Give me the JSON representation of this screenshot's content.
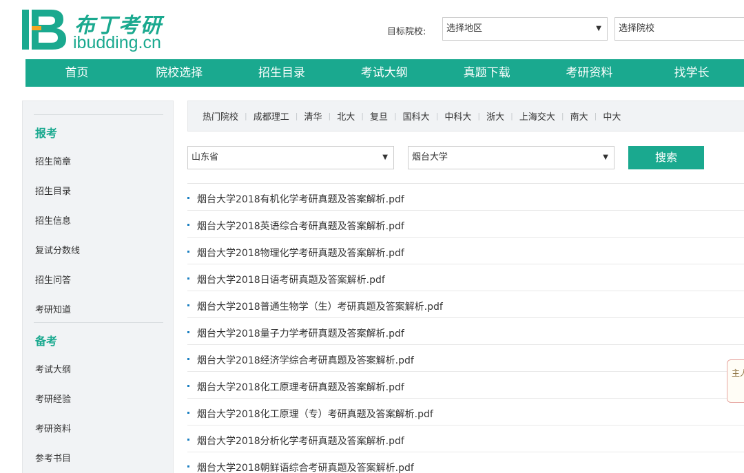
{
  "brand": {
    "name_cn": "布丁考研",
    "domain": "ibudding.cn",
    "accent_color": "#1aa98f"
  },
  "header": {
    "target_label": "目标院校:",
    "region_select": {
      "value": "选择地区"
    },
    "school_input": {
      "placeholder": "选择院校"
    }
  },
  "nav": {
    "items": [
      "首页",
      "院校选择",
      "招生目录",
      "考试大纲",
      "真题下载",
      "考研资料",
      "找学长"
    ]
  },
  "sidebar": {
    "sections": [
      {
        "heading": "报考",
        "items": [
          "招生简章",
          "招生目录",
          "招生信息",
          "复试分数线",
          "招生问答",
          "考研知道"
        ]
      },
      {
        "heading": "备考",
        "items": [
          "考试大纲",
          "考研经验",
          "考研资料",
          "参考书目"
        ]
      }
    ]
  },
  "hot_schools": {
    "items": [
      "热门院校",
      "成都理工",
      "清华",
      "北大",
      "复旦",
      "国科大",
      "中科大",
      "浙大",
      "上海交大",
      "南大",
      "中大"
    ]
  },
  "filters": {
    "province": "山东省",
    "university": "烟台大学",
    "search_label": "搜索"
  },
  "files": [
    "烟台大学2018有机化学考研真题及答案解析.pdf",
    "烟台大学2018英语综合考研真题及答案解析.pdf",
    "烟台大学2018物理化学考研真题及答案解析.pdf",
    "烟台大学2018日语考研真题及答案解析.pdf",
    "烟台大学2018普通生物学（生）考研真题及答案解析.pdf",
    "烟台大学2018量子力学考研真题及答案解析.pdf",
    "烟台大学2018经济学综合考研真题及答案解析.pdf",
    "烟台大学2018化工原理考研真题及答案解析.pdf",
    "烟台大学2018化工原理（专）考研真题及答案解析.pdf",
    "烟台大学2018分析化学考研真题及答案解析.pdf",
    "烟台大学2018朝鲜语综合考研真题及答案解析.pdf"
  ],
  "chat_widget": {
    "label": "主人"
  }
}
